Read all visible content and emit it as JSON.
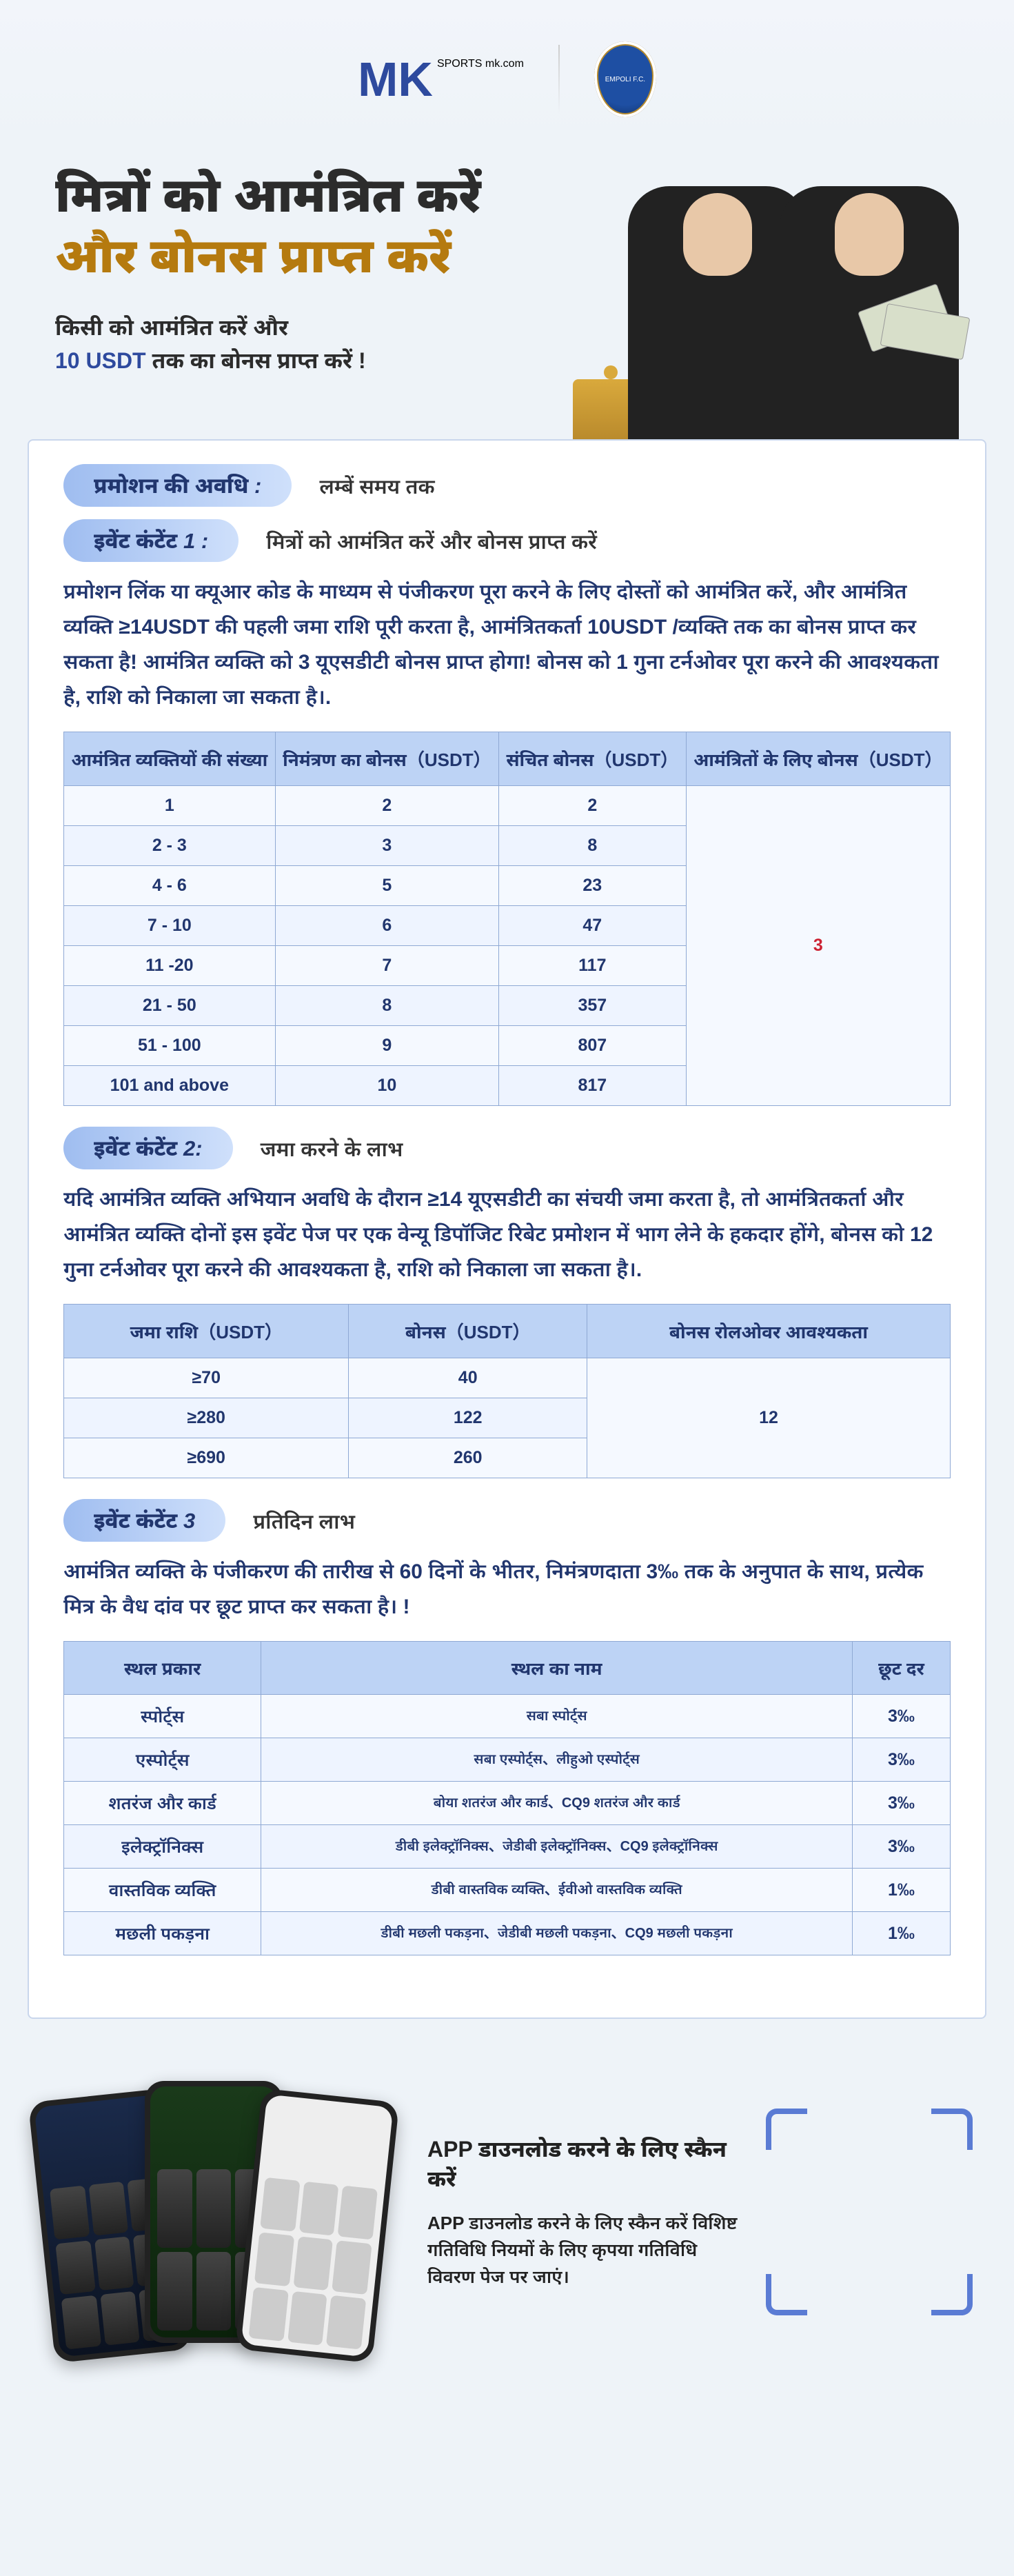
{
  "brand": {
    "logo_left": "MK",
    "logo_top": "SPORTS",
    "logo_sub": "mk.com",
    "crest_label": "EMPOLI F.C."
  },
  "hero": {
    "title_line1": "मित्रों को आमंत्रित करें",
    "title_line2": "और बोनस प्राप्त करें",
    "sub_line1": "किसी को आमंत्रित करें और",
    "sub_usdt": "10 USDT",
    "sub_line2_rest": " तक का बोनस प्राप्त करें !"
  },
  "section_period": {
    "pill": "प्रमोशन की अवधि :",
    "text": "लम्बें समय तक"
  },
  "event1": {
    "pill": "इवेंट कंटेंट 1 :",
    "text": "मित्रों को आमंत्रित करें और बोनस प्राप्त करें",
    "para": "प्रमोशन लिंक या क्यूआर कोड के माध्यम से पंजीकरण पूरा करने के लिए दोस्तों को आमंत्रित करें, और आमंत्रित व्यक्ति ≥14USDT की पहली जमा राशि पूरी करता है, आमंत्रितकर्ता 10USDT /व्यक्ति तक का बोनस प्राप्त कर सकता है! आमंत्रित व्यक्ति को 3 यूएसडीटी बोनस प्राप्त होगा! बोनस को 1 गुना टर्नओवर पूरा करने की आवश्यकता है, राशि को निकाला जा सकता है।.",
    "headers": [
      "आमंत्रित व्यक्तियों की संख्या",
      "निमंत्रण का बोनस（USDT）",
      "संचित बोनस（USDT）",
      "आमंत्रितों के लिए बोनस（USDT）"
    ],
    "rows": [
      [
        "1",
        "2",
        "2"
      ],
      [
        "2 - 3",
        "3",
        "8"
      ],
      [
        "4 - 6",
        "5",
        "23"
      ],
      [
        "7 - 10",
        "6",
        "47"
      ],
      [
        "11 -20",
        "7",
        "117"
      ],
      [
        "21 - 50",
        "8",
        "357"
      ],
      [
        "51 - 100",
        "9",
        "807"
      ],
      [
        "101 and above",
        "10",
        "817"
      ]
    ],
    "invitee_bonus": "3"
  },
  "event2": {
    "pill": "इवेंट कंटेंट 2:",
    "text": "जमा करने के लाभ",
    "para": "यदि आमंत्रित व्यक्ति अभियान अवधि के दौरान ≥14 यूएसडीटी का संचयी जमा करता है, तो आमंत्रितकर्ता और आमंत्रित व्यक्ति दोनों इस इवेंट पेज पर एक वेन्यू डिपॉजिट रिबेट प्रमोशन में भाग लेने के हकदार होंगे, बोनस को 12 गुना टर्नओवर पूरा करने की आवश्यकता है, राशि को निकाला जा सकता है।.",
    "headers": [
      "जमा राशि（USDT）",
      "बोनस（USDT）",
      "बोनस रोलओवर आवश्यकता"
    ],
    "rows": [
      [
        "≥70",
        "40"
      ],
      [
        "≥280",
        "122"
      ],
      [
        "≥690",
        "260"
      ]
    ],
    "rollover": "12"
  },
  "event3": {
    "pill": "इवेंट कंटेंट 3",
    "text": "प्रतिदिन लाभ",
    "para": "आमंत्रित व्यक्ति के पंजीकरण की तारीख से 60 दिनों के भीतर, निमंत्रणदाता 3‰ तक के अनुपात के साथ, प्रत्येक मित्र के वैध दांव पर छूट प्राप्त कर सकता है। !",
    "headers": [
      "स्थल प्रकार",
      "स्थल का नाम",
      "छूट दर"
    ],
    "rows": [
      [
        "स्पोर्ट्स",
        "सबा स्पोर्ट्स",
        "3‰"
      ],
      [
        "एस्पोर्ट्स",
        "सबा एस्पोर्ट्स、लीहुओ एस्पोर्ट्स",
        "3‰"
      ],
      [
        "शतरंज और कार्ड",
        "बोया शतरंज और कार्ड、CQ9 शतरंज और कार्ड",
        "3‰"
      ],
      [
        "इलेक्ट्रॉनिक्स",
        "डीबी इलेक्ट्रॉनिक्स、जेडीबी इलेक्ट्रॉनिक्स、CQ9 इलेक्ट्रॉनिक्स",
        "3‰"
      ],
      [
        "वास्तविक व्यक्ति",
        "डीबी वास्तविक व्यक्ति、ईवीओ वास्तविक व्यक्ति",
        "1‰"
      ],
      [
        "मछली पकड़ना",
        "डीबी मछली पकड़ना、जेडीबी मछली पकड़ना、CQ9 मछली पकड़ना",
        "1‰"
      ]
    ]
  },
  "footer": {
    "title": "APP  डाउनलोड करने के लिए स्कैन करें",
    "body": "APP  डाउनलोड करने के लिए स्कैन करें विशिष्ट गतिविधि नियमों के लिए कृपया गतिविधि विवरण पेज पर जाएं।"
  }
}
